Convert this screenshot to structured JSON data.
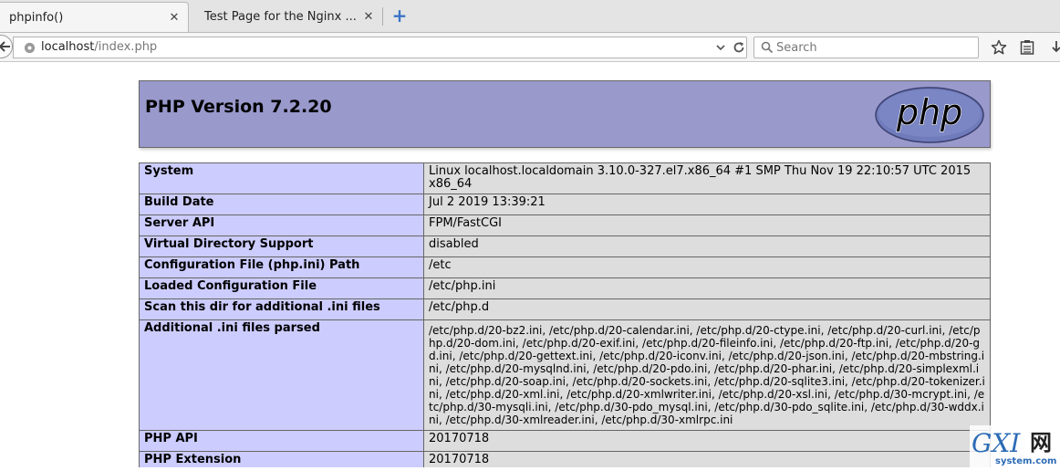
{
  "browser": {
    "tabs": [
      {
        "title": "phpinfo()",
        "close": "✕",
        "active": true
      },
      {
        "title": "Test Page for the Nginx ...",
        "close": "✕",
        "active": false
      }
    ],
    "new_tab": "+",
    "url": {
      "host": "localhost",
      "path": "/index.php"
    },
    "search_placeholder": "Search"
  },
  "page": {
    "header_title": "PHP Version 7.2.20",
    "logo_text": "php",
    "rows": [
      {
        "label": "System",
        "value": "Linux localhost.localdomain 3.10.0-327.el7.x86_64 #1 SMP Thu Nov 19 22:10:57 UTC 2015 x86_64"
      },
      {
        "label": "Build Date",
        "value": "Jul 2 2019 13:39:21"
      },
      {
        "label": "Server API",
        "value": "FPM/FastCGI"
      },
      {
        "label": "Virtual Directory Support",
        "value": "disabled"
      },
      {
        "label": "Configuration File (php.ini) Path",
        "value": "/etc"
      },
      {
        "label": "Loaded Configuration File",
        "value": "/etc/php.ini"
      },
      {
        "label": "Scan this dir for additional .ini files",
        "value": "/etc/php.d"
      },
      {
        "label": "Additional .ini files parsed",
        "value": "/etc/php.d/20-bz2.ini, /etc/php.d/20-calendar.ini, /etc/php.d/20-ctype.ini, /etc/php.d/20-curl.ini, /etc/php.d/20-dom.ini, /etc/php.d/20-exif.ini, /etc/php.d/20-fileinfo.ini, /etc/php.d/20-ftp.ini, /etc/php.d/20-gd.ini, /etc/php.d/20-gettext.ini, /etc/php.d/20-iconv.ini, /etc/php.d/20-json.ini, /etc/php.d/20-mbstring.ini, /etc/php.d/20-mysqlnd.ini, /etc/php.d/20-pdo.ini, /etc/php.d/20-phar.ini, /etc/php.d/20-simplexml.ini, /etc/php.d/20-soap.ini, /etc/php.d/20-sockets.ini, /etc/php.d/20-sqlite3.ini, /etc/php.d/20-tokenizer.ini, /etc/php.d/20-xml.ini, /etc/php.d/20-xmlwriter.ini, /etc/php.d/20-xsl.ini, /etc/php.d/30-mcrypt.ini, /etc/php.d/30-mysqli.ini, /etc/php.d/30-pdo_mysql.ini, /etc/php.d/30-pdo_sqlite.ini, /etc/php.d/30-wddx.ini, /etc/php.d/30-xmlreader.ini, /etc/php.d/30-xmlrpc.ini"
      },
      {
        "label": "PHP API",
        "value": "20170718"
      },
      {
        "label": "PHP Extension",
        "value": "20170718"
      }
    ]
  },
  "watermark": {
    "brand": "GXI",
    "glyph": "网",
    "domain": "system.com"
  },
  "colors": {
    "header_bg": "#9999cc",
    "label_bg": "#ccccff",
    "value_bg": "#dddddd",
    "new_tab_blue": "#3b74c8",
    "watermark_blue": "#2c6bb5"
  },
  "icons": [
    "back-arrow-icon",
    "globe-icon",
    "dropdown-arrow-icon",
    "reload-icon",
    "search-icon",
    "bookmark-star-icon",
    "reading-list-icon",
    "download-icon"
  ]
}
